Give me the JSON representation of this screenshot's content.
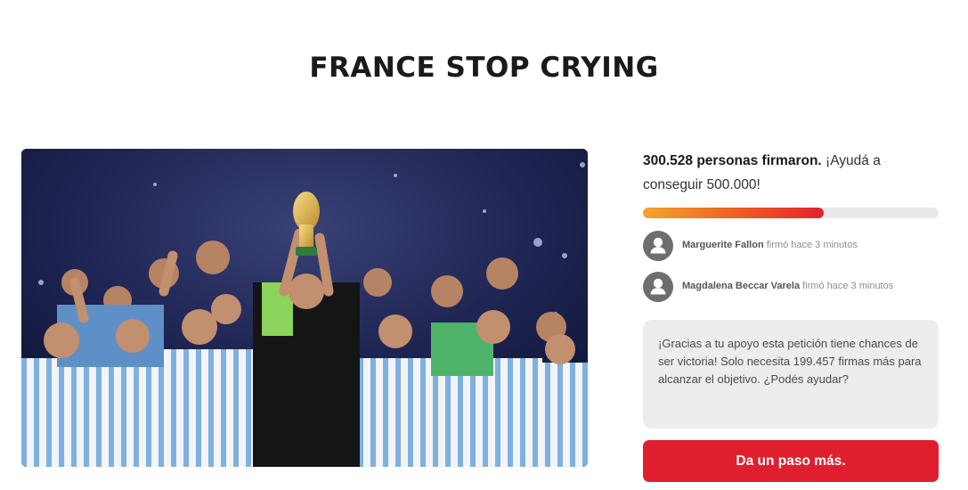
{
  "petition": {
    "title": "FRANCE STOP CRYING"
  },
  "hero": {
    "alt": "Argentina team celebrating with trophy"
  },
  "signatures": {
    "count_bold": "300.528 personas firmaron.",
    "count_rest": " ¡Ayudá a conseguir 500.000!",
    "progress": 0.61
  },
  "recent_signers": [
    {
      "name": "Marguerite Fallon",
      "action": " firmó hace 3 minutos"
    },
    {
      "name": "Magdalena Beccar Varela",
      "action": " firmó hace 3 minutos"
    }
  ],
  "notice": {
    "text": "¡Gracias a tu apoyo esta petición tiene chances de ser victoria! Solo necesita 199.457 firmas más para alcanzar el objetivo. ¿Podés ayudar?"
  },
  "cta": {
    "label": "Da un paso más."
  },
  "colors": {
    "accent": "#e01f2e",
    "progress_start": "#f4a52a",
    "progress_end": "#e2232e",
    "avatar": "#6e6e6e",
    "notice_bg": "#ededed"
  },
  "icons": {
    "avatar": "user-silhouette-icon",
    "trophy": "trophy-icon"
  }
}
